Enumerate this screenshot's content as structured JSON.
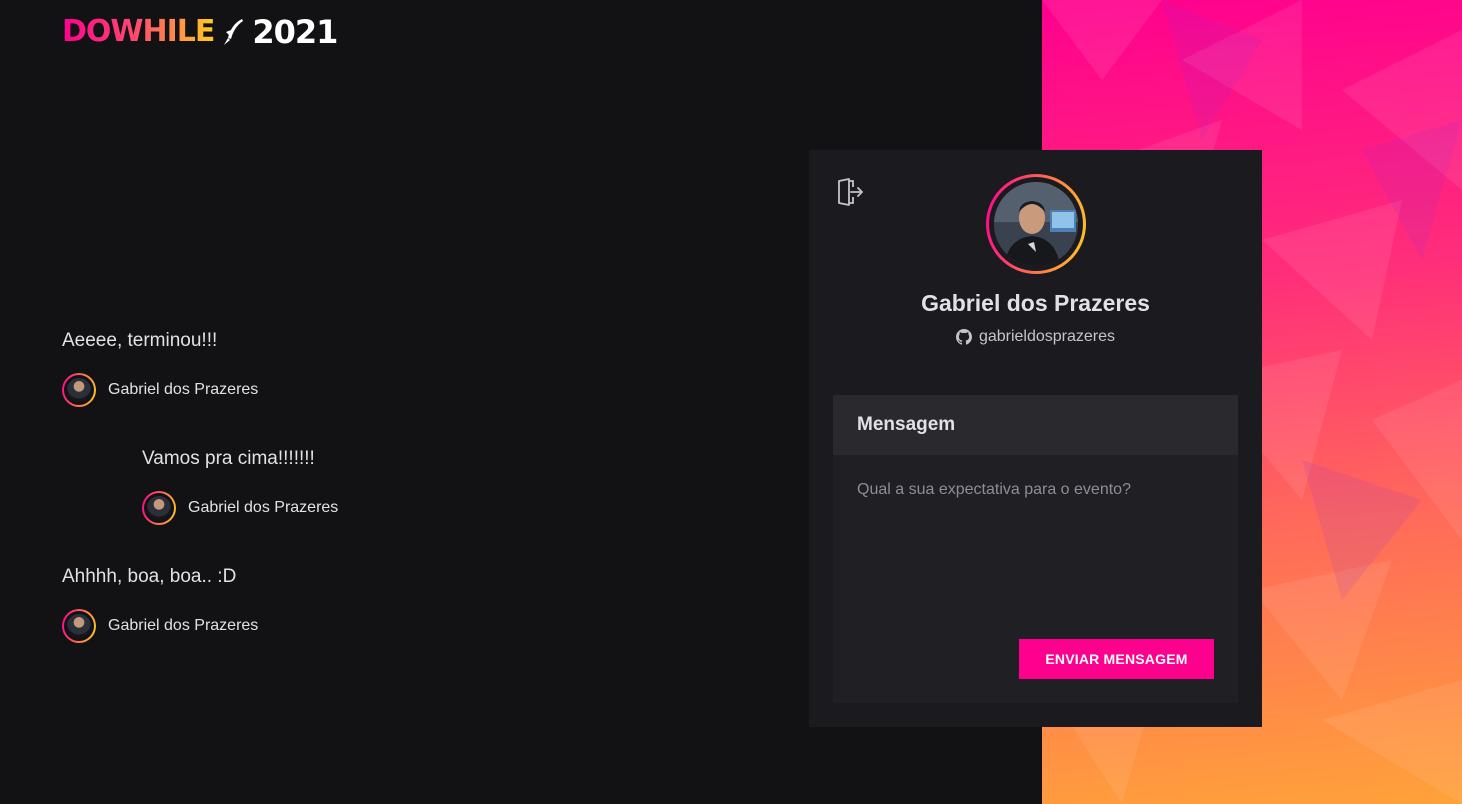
{
  "logo": {
    "wordmark": "DOWHILE",
    "year": "2021"
  },
  "messages": [
    {
      "text": "Aeeee, terminou!!!",
      "user": "Gabriel dos Prazeres"
    },
    {
      "text": "Vamos pra cima!!!!!!!",
      "user": "Gabriel dos Prazeres"
    },
    {
      "text": "Ahhhh, boa, boa.. :D",
      "user": "Gabriel dos Prazeres"
    }
  ],
  "profile": {
    "name": "Gabriel dos Prazeres",
    "login": "gabrieldosprazeres",
    "signout_icon": "sign-out-icon",
    "login_icon": "github-icon"
  },
  "form": {
    "title": "Mensagem",
    "placeholder": "Qual a sua expectativa para o evento?",
    "submit_label": "ENVIAR MENSAGEM"
  },
  "colors": {
    "background": "#121214",
    "card": "#1b1b1f",
    "accent": "#ff008e",
    "gradient_end": "#ffcd1e"
  }
}
